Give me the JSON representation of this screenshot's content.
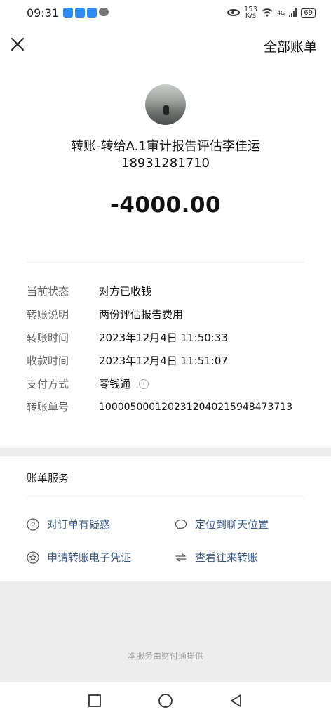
{
  "status_bar": {
    "time": "09:31",
    "net_speed_value": "153",
    "net_speed_unit": "K/s",
    "network_type": "4G",
    "battery": "69"
  },
  "header": {
    "close_icon": "close-icon",
    "all_bills": "全部账单"
  },
  "transfer": {
    "title": "转账-转给A.1审计报告评估李佳运",
    "phone": "18931281710",
    "amount": "-4000.00"
  },
  "details": [
    {
      "label": "当前状态",
      "value": "对方已收钱"
    },
    {
      "label": "转账说明",
      "value": "两份评估报告费用"
    },
    {
      "label": "转账时间",
      "value": "2023年12月4日 11:50:33"
    },
    {
      "label": "收款时间",
      "value": "2023年12月4日 11:51:07"
    },
    {
      "label": "支付方式",
      "value": "零钱通"
    },
    {
      "label": "转账单号",
      "value": "100005000120231204021594847371​3"
    }
  ],
  "services": {
    "title": "账单服务",
    "items": [
      {
        "label": "对订单有疑惑",
        "icon": "question-icon"
      },
      {
        "label": "定位到聊天位置",
        "icon": "chat-bubble-icon"
      },
      {
        "label": "申请转账电子凭证",
        "icon": "star-badge-icon"
      },
      {
        "label": "查看往来转账",
        "icon": "swap-arrows-icon"
      }
    ]
  },
  "footer": "本服务由财付通提供",
  "colors": {
    "link": "#3a5a8c",
    "background": "#ededed"
  }
}
